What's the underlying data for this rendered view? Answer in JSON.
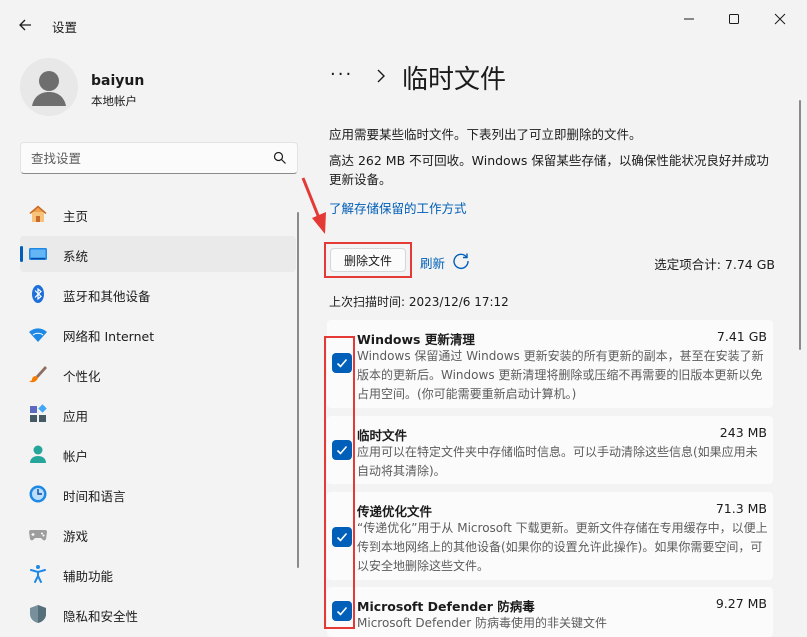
{
  "window": {
    "title": "设置",
    "controls": [
      "minimize",
      "maximize",
      "close"
    ]
  },
  "user": {
    "name": "baiyun",
    "account_type": "本地帐户"
  },
  "search": {
    "placeholder": "查找设置"
  },
  "sidebar": {
    "items": [
      {
        "label": "主页",
        "icon": "home-icon",
        "active": false
      },
      {
        "label": "系统",
        "icon": "system-display-icon",
        "active": true
      },
      {
        "label": "蓝牙和其他设备",
        "icon": "bluetooth-icon",
        "active": false
      },
      {
        "label": "网络和 Internet",
        "icon": "wifi-icon",
        "active": false
      },
      {
        "label": "个性化",
        "icon": "brush-icon",
        "active": false
      },
      {
        "label": "应用",
        "icon": "apps-icon",
        "active": false
      },
      {
        "label": "帐户",
        "icon": "account-icon",
        "active": false
      },
      {
        "label": "时间和语言",
        "icon": "clock-globe-icon",
        "active": false
      },
      {
        "label": "游戏",
        "icon": "gamepad-icon",
        "active": false
      },
      {
        "label": "辅助功能",
        "icon": "accessibility-icon",
        "active": false
      },
      {
        "label": "隐私和安全性",
        "icon": "shield-icon",
        "active": false
      }
    ]
  },
  "main": {
    "breadcrumb_more": "···",
    "page_title": "临时文件",
    "description1": "应用需要某些临时文件。下表列出了可立即删除的文件。",
    "description2": "高达 262 MB 不可回收。Windows 保留某些存储，以确保性能状况良好并成功更新设备。",
    "learn_link": "了解存储保留的工作方式",
    "delete_button": "删除文件",
    "refresh_link": "刷新",
    "selected_total": "选定项合计: 7.74 GB",
    "last_scan": "上次扫描时间: 2023/12/6 17:12",
    "items": [
      {
        "title": "Windows 更新清理",
        "size": "7.41 GB",
        "description": "Windows 保留通过 Windows 更新安装的所有更新的副本，甚至在安装了新版本的更新后。Windows 更新清理将删除或压缩不再需要的旧版本更新以免占用空间。(你可能需要重新启动计算机。)",
        "checked": true
      },
      {
        "title": "临时文件",
        "size": "243 MB",
        "description": "应用可以在特定文件夹中存储临时信息。可以手动清除这些信息(如果应用未自动将其清除)。",
        "checked": true
      },
      {
        "title": "传递优化文件",
        "size": "71.3 MB",
        "description": "“传递优化”用于从 Microsoft 下载更新。更新文件存储在专用缓存中，以便上传到本地网络上的其他设备(如果你的设置允许此操作)。如果你需要空间，可以安全地删除这些文件。",
        "checked": true
      },
      {
        "title": "Microsoft Defender 防病毒",
        "size": "9.27 MB",
        "description": "Microsoft Defender 防病毒使用的非关键文件",
        "checked": true
      }
    ]
  },
  "colors": {
    "accent": "#005fb8",
    "annotation": "#e53935",
    "background": "#f3f3f3",
    "card": "#fbfbfb"
  }
}
